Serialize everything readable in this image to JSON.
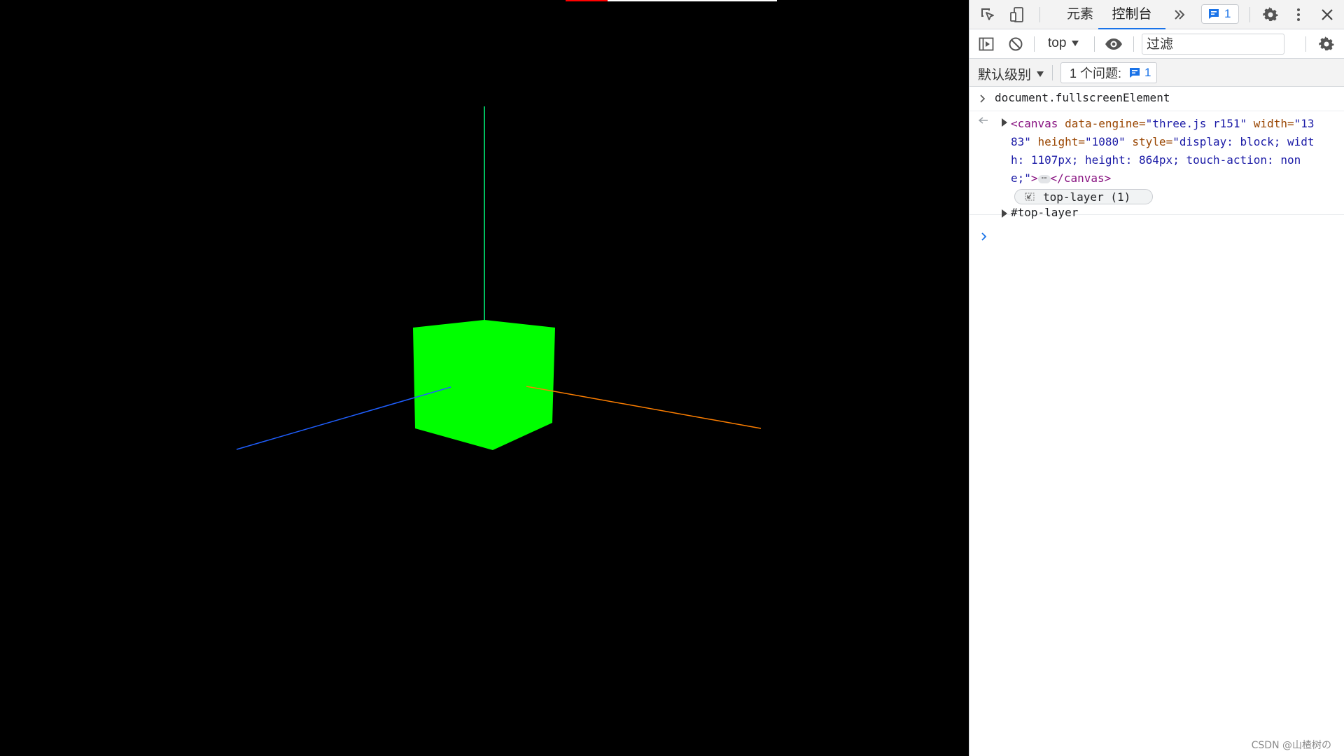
{
  "viewport": {
    "colors": {
      "background": "#000000",
      "cube": "#00ff00",
      "axis_x": "#ff7f00",
      "axis_y": "#00ff7f",
      "axis_z": "#1f5fff",
      "top_bar_red": "#ff0000",
      "top_bar_white": "#ffffff"
    }
  },
  "devtools": {
    "tabs": [
      {
        "label": "元素",
        "active": false
      },
      {
        "label": "控制台",
        "active": true
      }
    ],
    "issues_badge_count": "1",
    "context_select": "top",
    "filter_placeholder": "过滤",
    "level_select": "默认级别",
    "issues_button_label": "1 个问题:",
    "issues_button_count": "1",
    "icons": [
      "inspect-icon",
      "device-toggle-icon",
      "more-tabs-icon",
      "issues-icon",
      "settings-icon",
      "more-menu-icon",
      "close-icon",
      "sidebar-toggle-icon",
      "clear-console-icon",
      "eye-icon",
      "console-settings-icon",
      "top-layer-icon"
    ]
  },
  "console": {
    "command": "document.fullscreenElement",
    "result": {
      "tag_open": "<canvas",
      "attr1_name": " data-engine=",
      "attr1_value": "\"three.js r151\"",
      "attr2_name": " width=",
      "attr2_value": "\"1383\"",
      "attr3_name": " height=",
      "attr3_value": "\"1080\"",
      "attr4_name": " style=",
      "attr4_value": "\"display: block; width: 1107px; height: 864px; touch-action: none;\"",
      "tag_gt": ">",
      "tag_close": "</canvas>"
    },
    "chip_label": "top-layer (1)",
    "toplayer_label": "#top-layer"
  },
  "watermark": "CSDN @山楂树の"
}
